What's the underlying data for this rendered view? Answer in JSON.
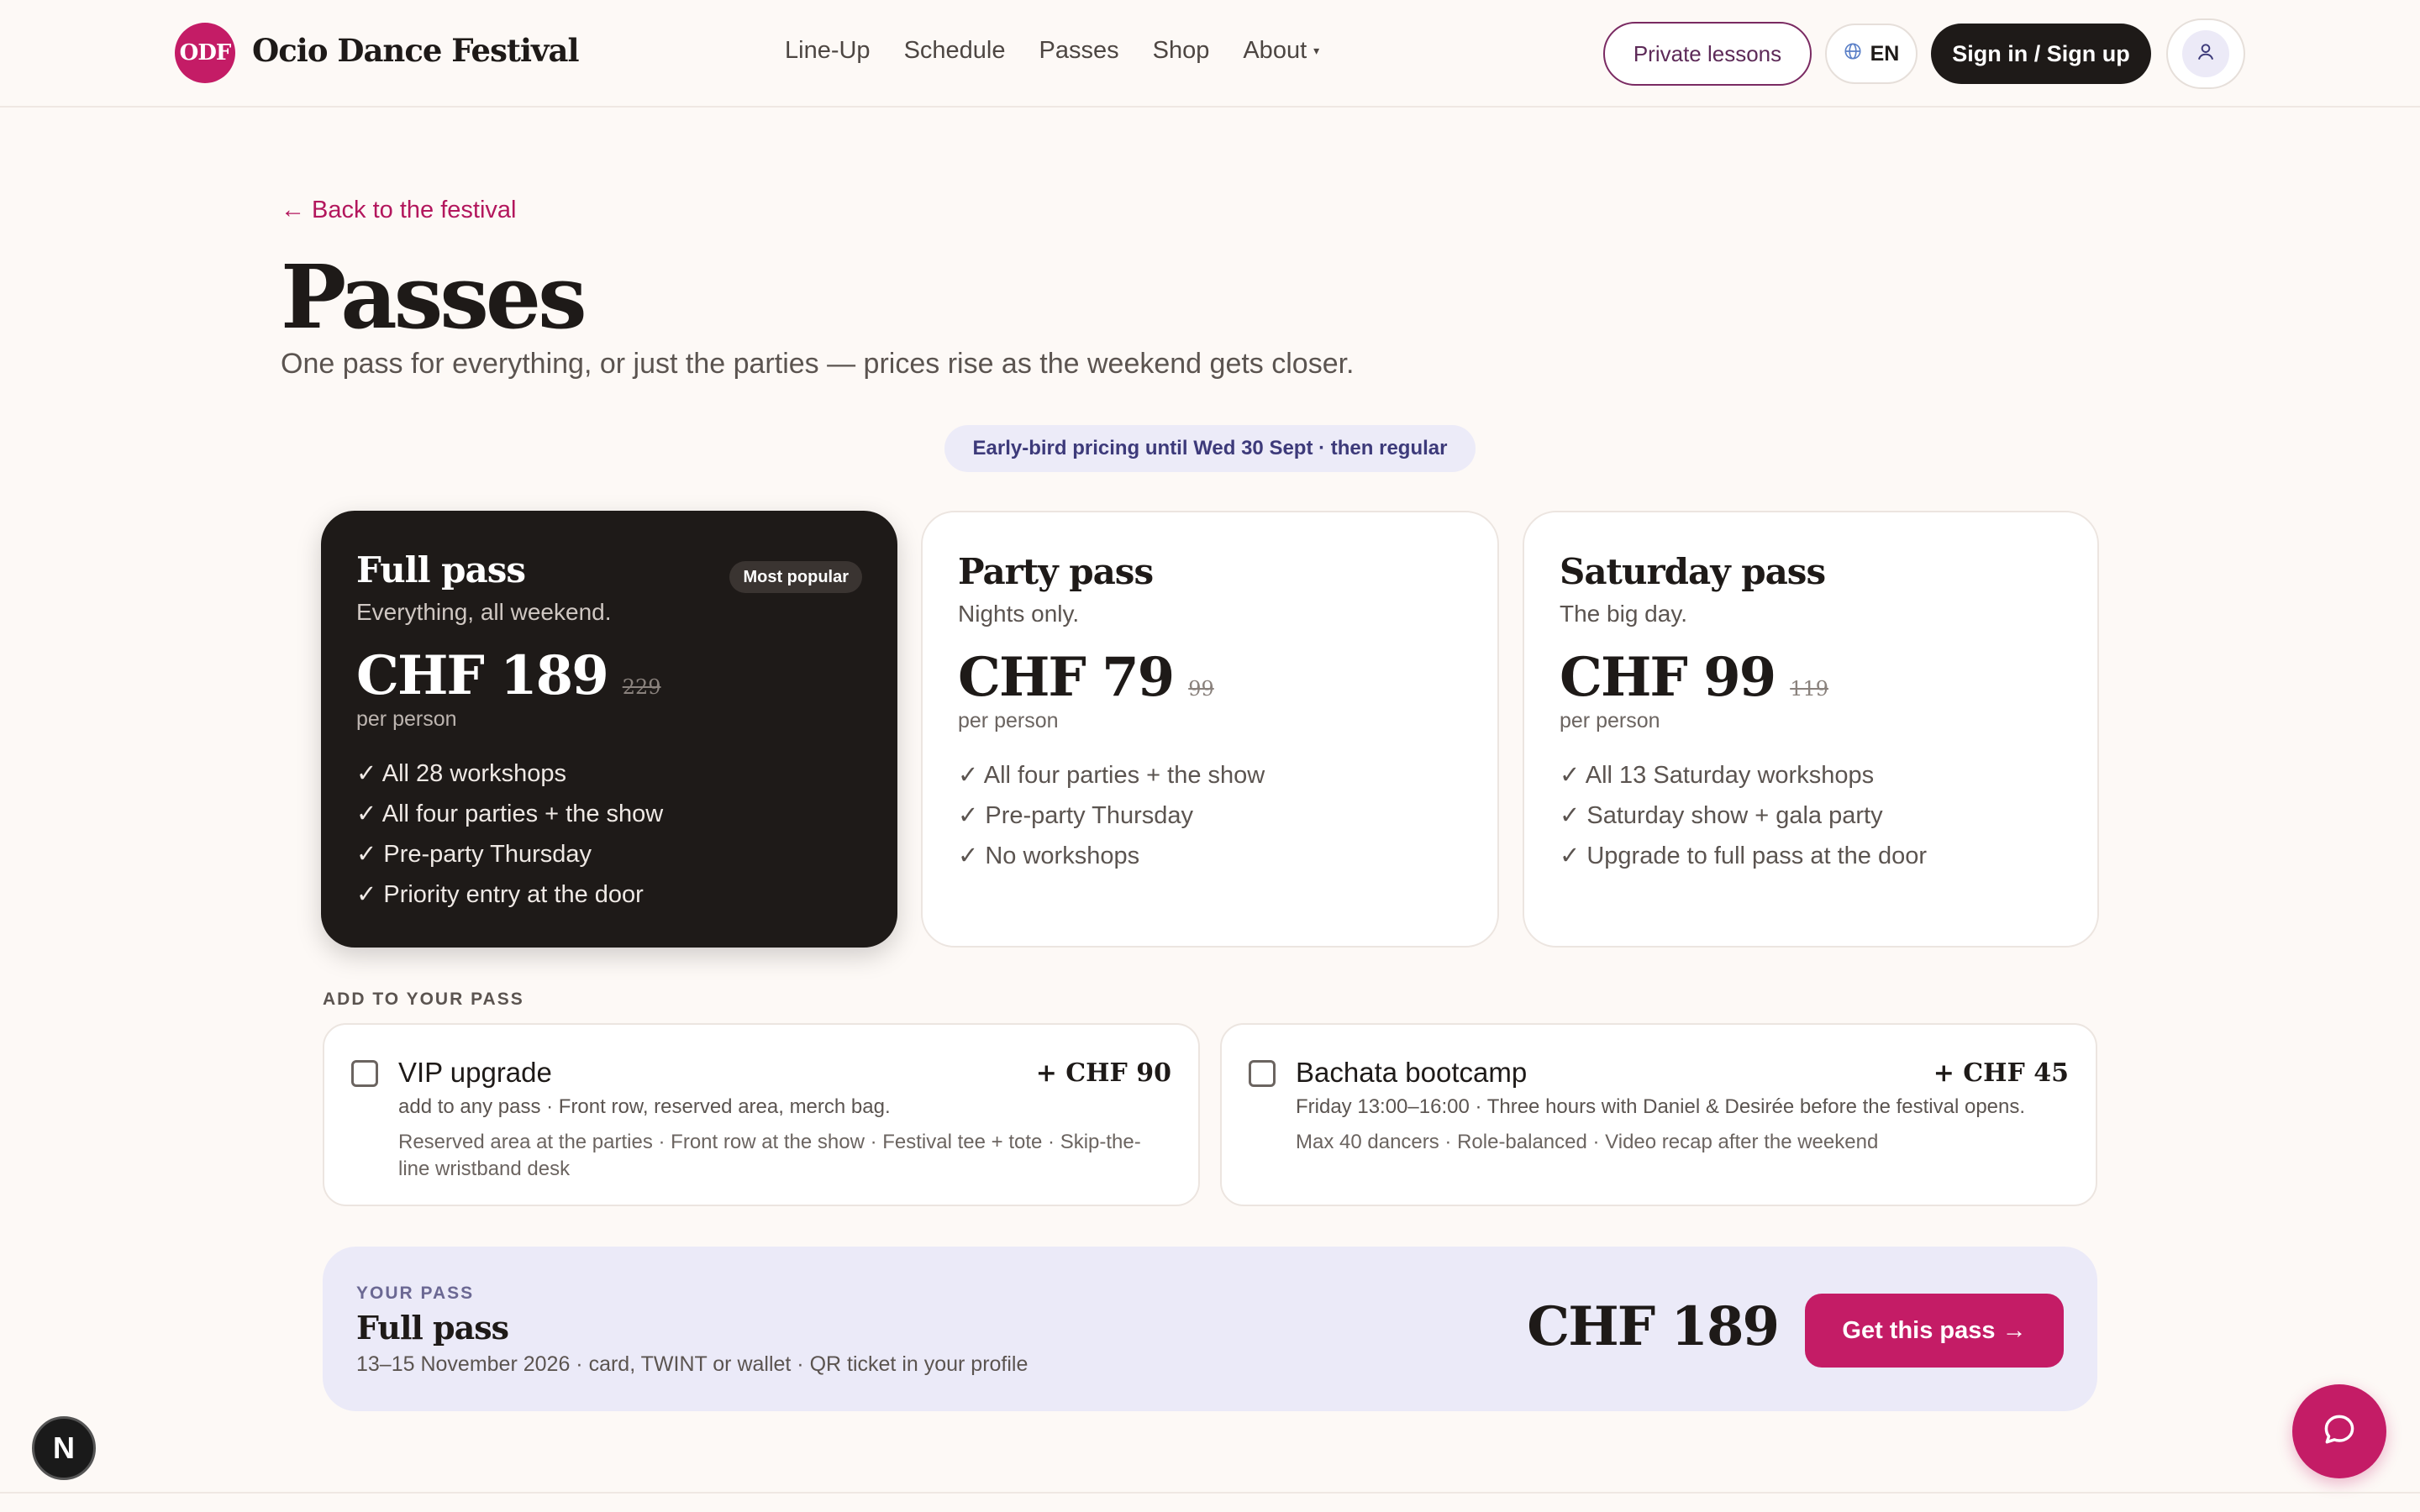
{
  "header": {
    "logo_text": "ODF",
    "brand": "Ocio Dance Festival",
    "nav": [
      {
        "label": "Line-Up"
      },
      {
        "label": "Schedule"
      },
      {
        "label": "Passes"
      },
      {
        "label": "Shop"
      },
      {
        "label": "About"
      }
    ],
    "private_lessons": "Private lessons",
    "language": "EN",
    "sign_in": "Sign in / Sign up",
    "icons": {
      "language": "globe-icon",
      "user": "user-icon",
      "about_caret": "caret-down-icon"
    }
  },
  "intro": {
    "back_link": "← Back to the festival",
    "title": "Passes",
    "subtitle": "One pass for everything, or just the parties — prices rise as the weekend gets closer.",
    "pricing_pill": "Early-bird pricing until Wed 30 Sept · then regular"
  },
  "passes": [
    {
      "title": "Full pass",
      "subtitle": "Everything, all weekend.",
      "badge": "Most popular",
      "price": "CHF 189",
      "old_price": "229",
      "per": "per person",
      "features": [
        "✓ All 28 workshops",
        "✓ All four parties + the show",
        "✓ Pre-party Thursday",
        "✓ Priority entry at the door"
      ],
      "selected": true
    },
    {
      "title": "Party pass",
      "subtitle": "Nights only.",
      "price": "CHF 79",
      "old_price": "99",
      "per": "per person",
      "features": [
        "✓ All four parties + the show",
        "✓ Pre-party Thursday",
        "✓ No workshops"
      ]
    },
    {
      "title": "Saturday pass",
      "subtitle": "The big day.",
      "price": "CHF 99",
      "old_price": "119",
      "per": "per person",
      "features": [
        "✓ All 13 Saturday workshops",
        "✓ Saturday show + gala party",
        "✓ Upgrade to full pass at the door"
      ]
    }
  ],
  "addons": {
    "heading": "ADD TO YOUR PASS",
    "items": [
      {
        "name": "VIP upgrade",
        "price": "+ CHF 90",
        "desc": "add to any pass · Front row, reserved area, merch bag.",
        "detail": "Reserved area at the parties · Front row at the show · Festival tee + tote · Skip-the-line wristband desk",
        "checked": false
      },
      {
        "name": "Bachata bootcamp",
        "price": "+ CHF 45",
        "desc": "Friday 13:00–16:00 · Three hours with Daniel & Desirée before the festival opens.",
        "detail": "Max 40 dancers · Role-balanced · Video recap after the weekend",
        "checked": false
      }
    ]
  },
  "summary": {
    "label": "YOUR PASS",
    "title": "Full pass",
    "meta": "13–15 November 2026 · card, TWINT or wallet · QR ticket in your profile",
    "price": "CHF 189",
    "cta": "Get this pass →"
  },
  "floating": {
    "dev_badge": "N",
    "chat_icon": "chat-bubble-icon"
  },
  "colors": {
    "accent": "#c41c66",
    "dark": "#1e1a18",
    "background": "#fdf9f6",
    "lavender": "#ebeaf8"
  }
}
